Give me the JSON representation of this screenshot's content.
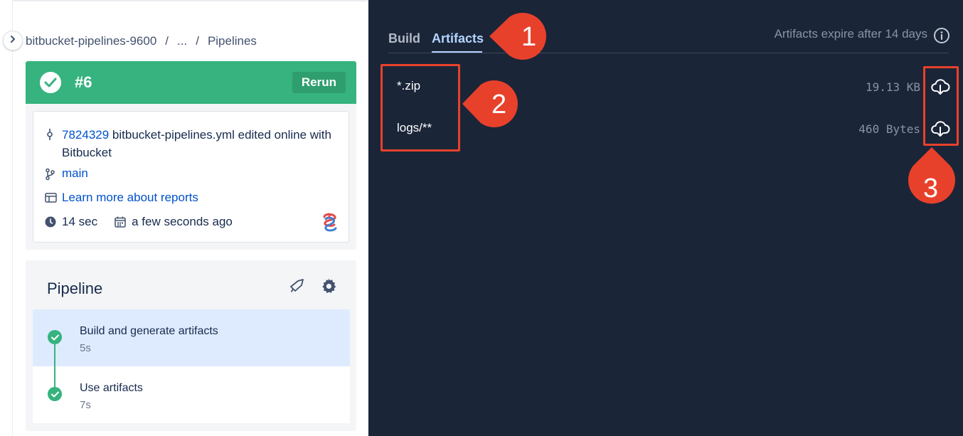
{
  "breadcrumb": {
    "repo": "bitbucket-pipelines-9600",
    "sep": "/",
    "ellipsis": "...",
    "current": "Pipelines"
  },
  "build": {
    "number": "#6",
    "rerun_label": "Rerun",
    "status_color": "#36b37e"
  },
  "commit": {
    "hash": "7824329",
    "message": "bitbucket-pipelines.yml edited online with Bitbucket",
    "branch": "main",
    "reports_link": "Learn more about reports",
    "duration": "14 sec",
    "when": "a few seconds ago"
  },
  "pipeline": {
    "title": "Pipeline",
    "steps": [
      {
        "name": "Build and generate artifacts",
        "time": "5s",
        "status": "success"
      },
      {
        "name": "Use artifacts",
        "time": "7s",
        "status": "success"
      }
    ]
  },
  "tabs": [
    {
      "label": "Build"
    },
    {
      "label": "Artifacts"
    }
  ],
  "expire_note": "Artifacts expire after 14 days",
  "artifacts": [
    {
      "name": "*.zip",
      "size": "19.13 KB"
    },
    {
      "name": "logs/**",
      "size": "460 Bytes"
    }
  ],
  "callouts": [
    "1",
    "2",
    "3"
  ],
  "colors": {
    "dark_panel": "#1b2538",
    "accent": "#b3d4ff",
    "annotation": "#e8412b",
    "link": "#0052cc"
  }
}
